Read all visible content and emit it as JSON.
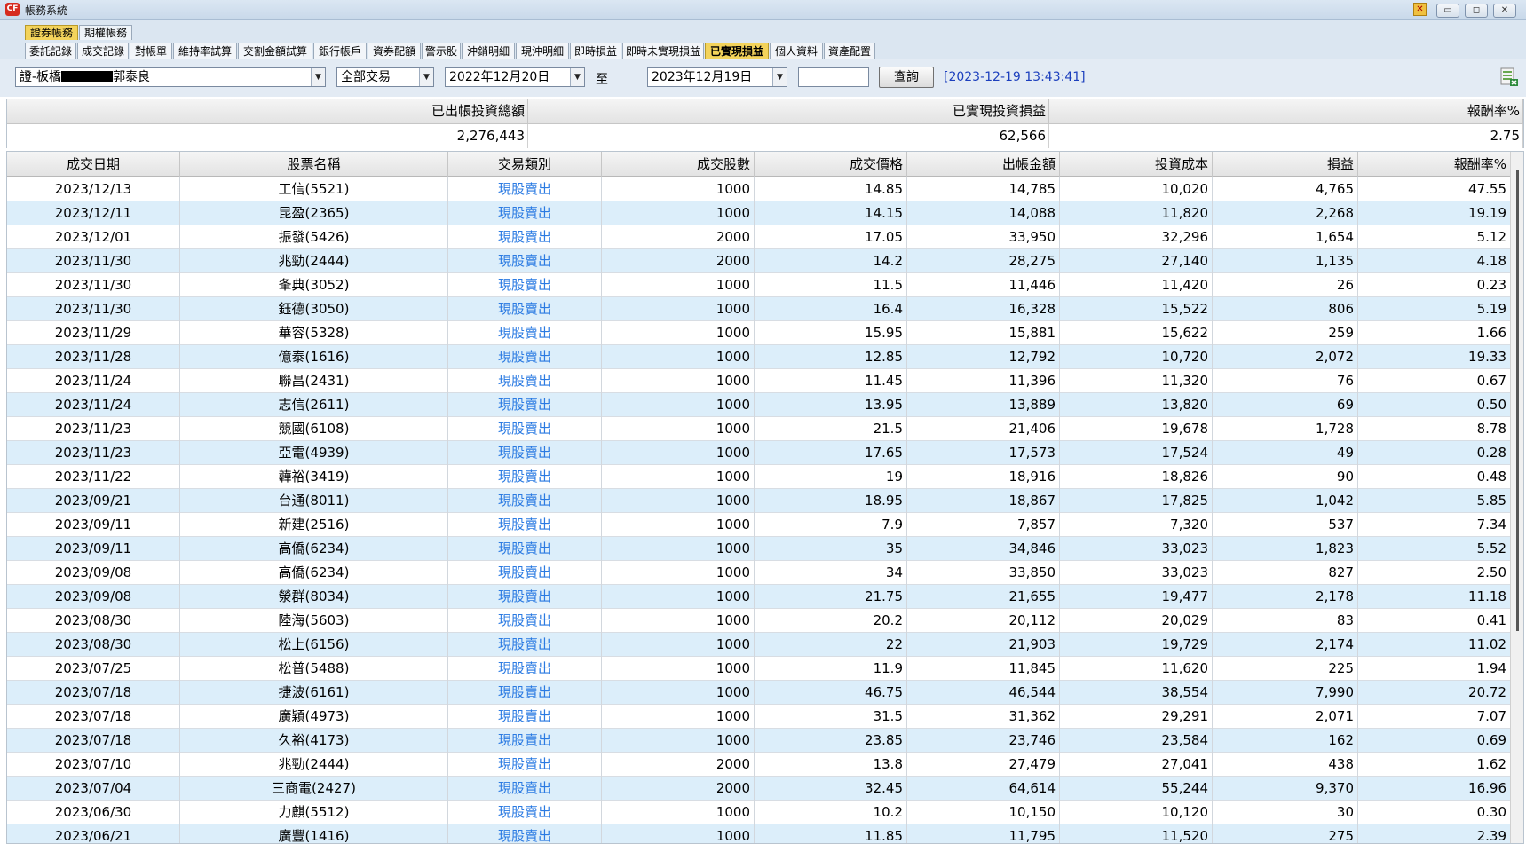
{
  "window": {
    "title": "帳務系統",
    "icon_text": "CF",
    "pin_label": "✕",
    "min_label": "▭",
    "max_label": "◻",
    "close_label": "✕"
  },
  "top_tabs": [
    "證券帳務",
    "期權帳務"
  ],
  "sub_tabs": [
    "委託記錄",
    "成交記錄",
    "對帳單",
    "維持率試算",
    "交割金額試算",
    "銀行帳戶",
    "資券配額",
    "警示股",
    "沖銷明細",
    "現沖明細",
    "即時損益",
    "即時未實現損益",
    "已實現損益",
    "個人資料",
    "資產配置"
  ],
  "filters": {
    "account_prefix": "證-板橋",
    "account_suffix": "郭泰良",
    "trade_type": "全部交易",
    "date_from": "2022年12月20日",
    "to_label": "至",
    "date_to": "2023年12月19日",
    "query_button": "查詢",
    "timestamp": "[2023-12-19 13:43:41]"
  },
  "summary": {
    "headers": [
      "已出帳投資總額",
      "已實現投資損益",
      "報酬率%"
    ],
    "values": [
      "2,276,443",
      "62,566",
      "2.75"
    ]
  },
  "table": {
    "columns": [
      "成交日期",
      "股票名稱",
      "交易類別",
      "成交股數",
      "成交價格",
      "出帳金額",
      "投資成本",
      "損益",
      "報酬率%"
    ],
    "rows": [
      [
        "2023/12/13",
        "工信(5521)",
        "現股賣出",
        "1000",
        "14.85",
        "14,785",
        "10,020",
        "4,765",
        "47.55"
      ],
      [
        "2023/12/11",
        "昆盈(2365)",
        "現股賣出",
        "1000",
        "14.15",
        "14,088",
        "11,820",
        "2,268",
        "19.19"
      ],
      [
        "2023/12/01",
        "振發(5426)",
        "現股賣出",
        "2000",
        "17.05",
        "33,950",
        "32,296",
        "1,654",
        "5.12"
      ],
      [
        "2023/11/30",
        "兆勁(2444)",
        "現股賣出",
        "2000",
        "14.2",
        "28,275",
        "27,140",
        "1,135",
        "4.18"
      ],
      [
        "2023/11/30",
        "夆典(3052)",
        "現股賣出",
        "1000",
        "11.5",
        "11,446",
        "11,420",
        "26",
        "0.23"
      ],
      [
        "2023/11/30",
        "鈺德(3050)",
        "現股賣出",
        "1000",
        "16.4",
        "16,328",
        "15,522",
        "806",
        "5.19"
      ],
      [
        "2023/11/29",
        "華容(5328)",
        "現股賣出",
        "1000",
        "15.95",
        "15,881",
        "15,622",
        "259",
        "1.66"
      ],
      [
        "2023/11/28",
        "億泰(1616)",
        "現股賣出",
        "1000",
        "12.85",
        "12,792",
        "10,720",
        "2,072",
        "19.33"
      ],
      [
        "2023/11/24",
        "聯昌(2431)",
        "現股賣出",
        "1000",
        "11.45",
        "11,396",
        "11,320",
        "76",
        "0.67"
      ],
      [
        "2023/11/24",
        "志信(2611)",
        "現股賣出",
        "1000",
        "13.95",
        "13,889",
        "13,820",
        "69",
        "0.50"
      ],
      [
        "2023/11/23",
        "競國(6108)",
        "現股賣出",
        "1000",
        "21.5",
        "21,406",
        "19,678",
        "1,728",
        "8.78"
      ],
      [
        "2023/11/23",
        "亞電(4939)",
        "現股賣出",
        "1000",
        "17.65",
        "17,573",
        "17,524",
        "49",
        "0.28"
      ],
      [
        "2023/11/22",
        "韡裕(3419)",
        "現股賣出",
        "1000",
        "19",
        "18,916",
        "18,826",
        "90",
        "0.48"
      ],
      [
        "2023/09/21",
        "台通(8011)",
        "現股賣出",
        "1000",
        "18.95",
        "18,867",
        "17,825",
        "1,042",
        "5.85"
      ],
      [
        "2023/09/11",
        "新建(2516)",
        "現股賣出",
        "1000",
        "7.9",
        "7,857",
        "7,320",
        "537",
        "7.34"
      ],
      [
        "2023/09/11",
        "高僑(6234)",
        "現股賣出",
        "1000",
        "35",
        "34,846",
        "33,023",
        "1,823",
        "5.52"
      ],
      [
        "2023/09/08",
        "高僑(6234)",
        "現股賣出",
        "1000",
        "34",
        "33,850",
        "33,023",
        "827",
        "2.50"
      ],
      [
        "2023/09/08",
        "滎群(8034)",
        "現股賣出",
        "1000",
        "21.75",
        "21,655",
        "19,477",
        "2,178",
        "11.18"
      ],
      [
        "2023/08/30",
        "陸海(5603)",
        "現股賣出",
        "1000",
        "20.2",
        "20,112",
        "20,029",
        "83",
        "0.41"
      ],
      [
        "2023/08/30",
        "松上(6156)",
        "現股賣出",
        "1000",
        "22",
        "21,903",
        "19,729",
        "2,174",
        "11.02"
      ],
      [
        "2023/07/25",
        "松普(5488)",
        "現股賣出",
        "1000",
        "11.9",
        "11,845",
        "11,620",
        "225",
        "1.94"
      ],
      [
        "2023/07/18",
        "捷波(6161)",
        "現股賣出",
        "1000",
        "46.75",
        "46,544",
        "38,554",
        "7,990",
        "20.72"
      ],
      [
        "2023/07/18",
        "廣穎(4973)",
        "現股賣出",
        "1000",
        "31.5",
        "31,362",
        "29,291",
        "2,071",
        "7.07"
      ],
      [
        "2023/07/18",
        "久裕(4173)",
        "現股賣出",
        "1000",
        "23.85",
        "23,746",
        "23,584",
        "162",
        "0.69"
      ],
      [
        "2023/07/10",
        "兆勁(2444)",
        "現股賣出",
        "2000",
        "13.8",
        "27,479",
        "27,041",
        "438",
        "1.62"
      ],
      [
        "2023/07/04",
        "三商電(2427)",
        "現股賣出",
        "2000",
        "32.45",
        "64,614",
        "55,244",
        "9,370",
        "16.96"
      ],
      [
        "2023/06/30",
        "力麒(5512)",
        "現股賣出",
        "1000",
        "10.2",
        "10,150",
        "10,120",
        "30",
        "0.30"
      ],
      [
        "2023/06/21",
        "廣豐(1416)",
        "現股賣出",
        "1000",
        "11.85",
        "11,795",
        "11,520",
        "275",
        "2.39"
      ]
    ]
  }
}
